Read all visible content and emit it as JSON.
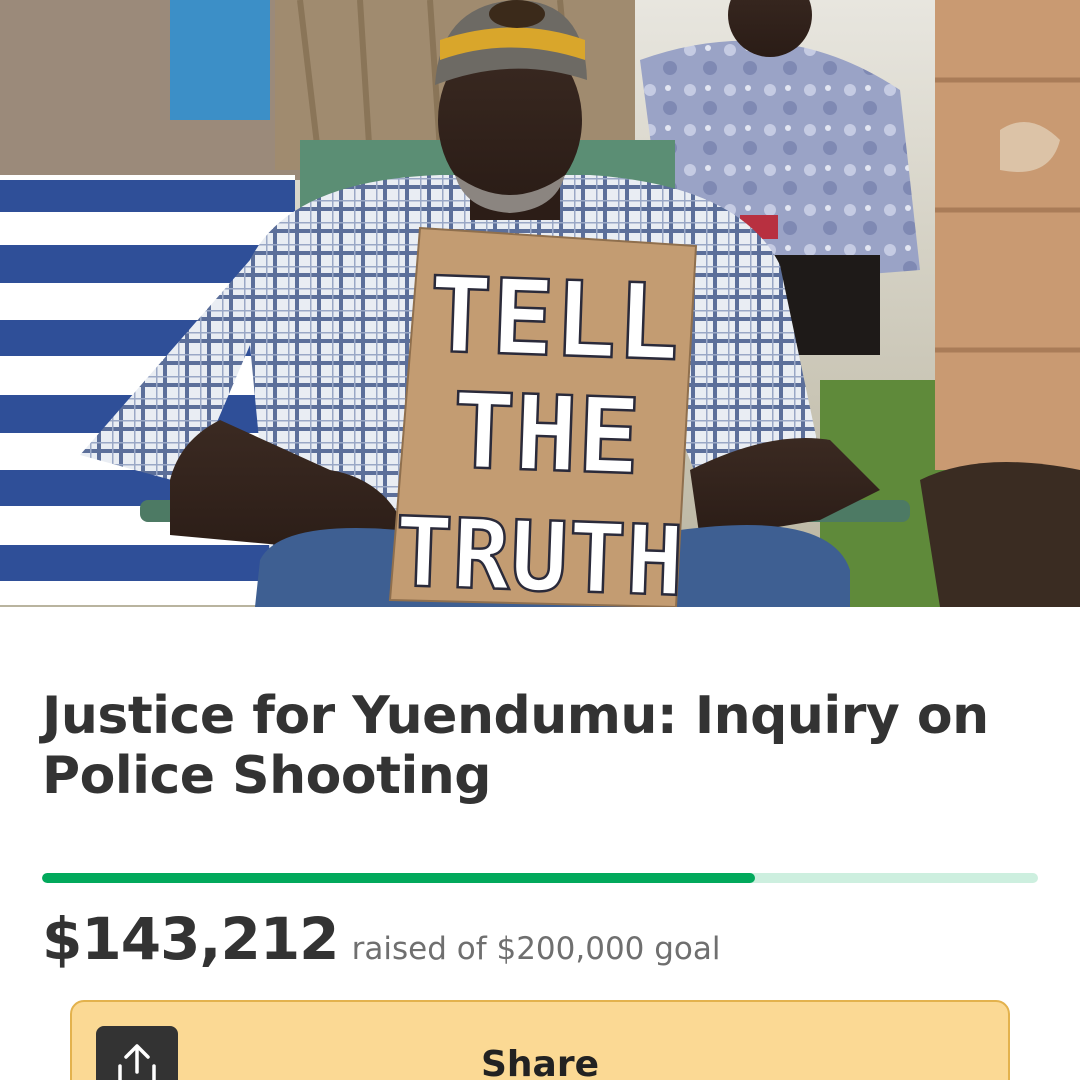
{
  "hero": {
    "sign_lines": [
      "TELL",
      "THE",
      "TRUTH"
    ]
  },
  "campaign": {
    "title": "Justice for Yuendumu: Inquiry on Police Shooting",
    "raised_amount": "$143,212",
    "goal_text": "raised of $200,000 goal",
    "progress_fraction": 0.716
  },
  "actions": {
    "share_label": "Share",
    "share_icon": "share-upload-icon"
  },
  "colors": {
    "progress_fill": "#02a95c",
    "progress_track": "#cdefdf",
    "share_button_bg": "#fbd994",
    "text_primary": "#333333"
  }
}
